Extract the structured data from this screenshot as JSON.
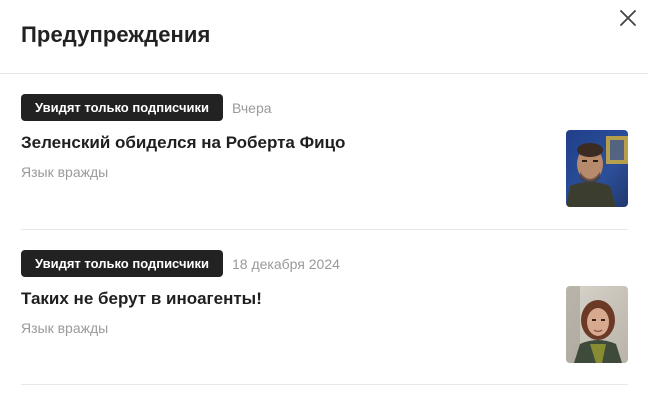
{
  "header": {
    "title": "Предупреждения"
  },
  "items": [
    {
      "badge": "Увидят только подписчики",
      "date": "Вчера",
      "headline": "Зеленский обиделся на Роберта Фицо",
      "reason": "Язык вражды"
    },
    {
      "badge": "Увидят только подписчики",
      "date": "18 декабря 2024",
      "headline": "Таких не берут в иноагенты!",
      "reason": "Язык вражды"
    }
  ],
  "colors": {
    "badge_bg": "#222222",
    "muted_text": "#9a9a9a",
    "divider": "#e8e8e8"
  },
  "icons": {
    "close": "close-icon"
  }
}
